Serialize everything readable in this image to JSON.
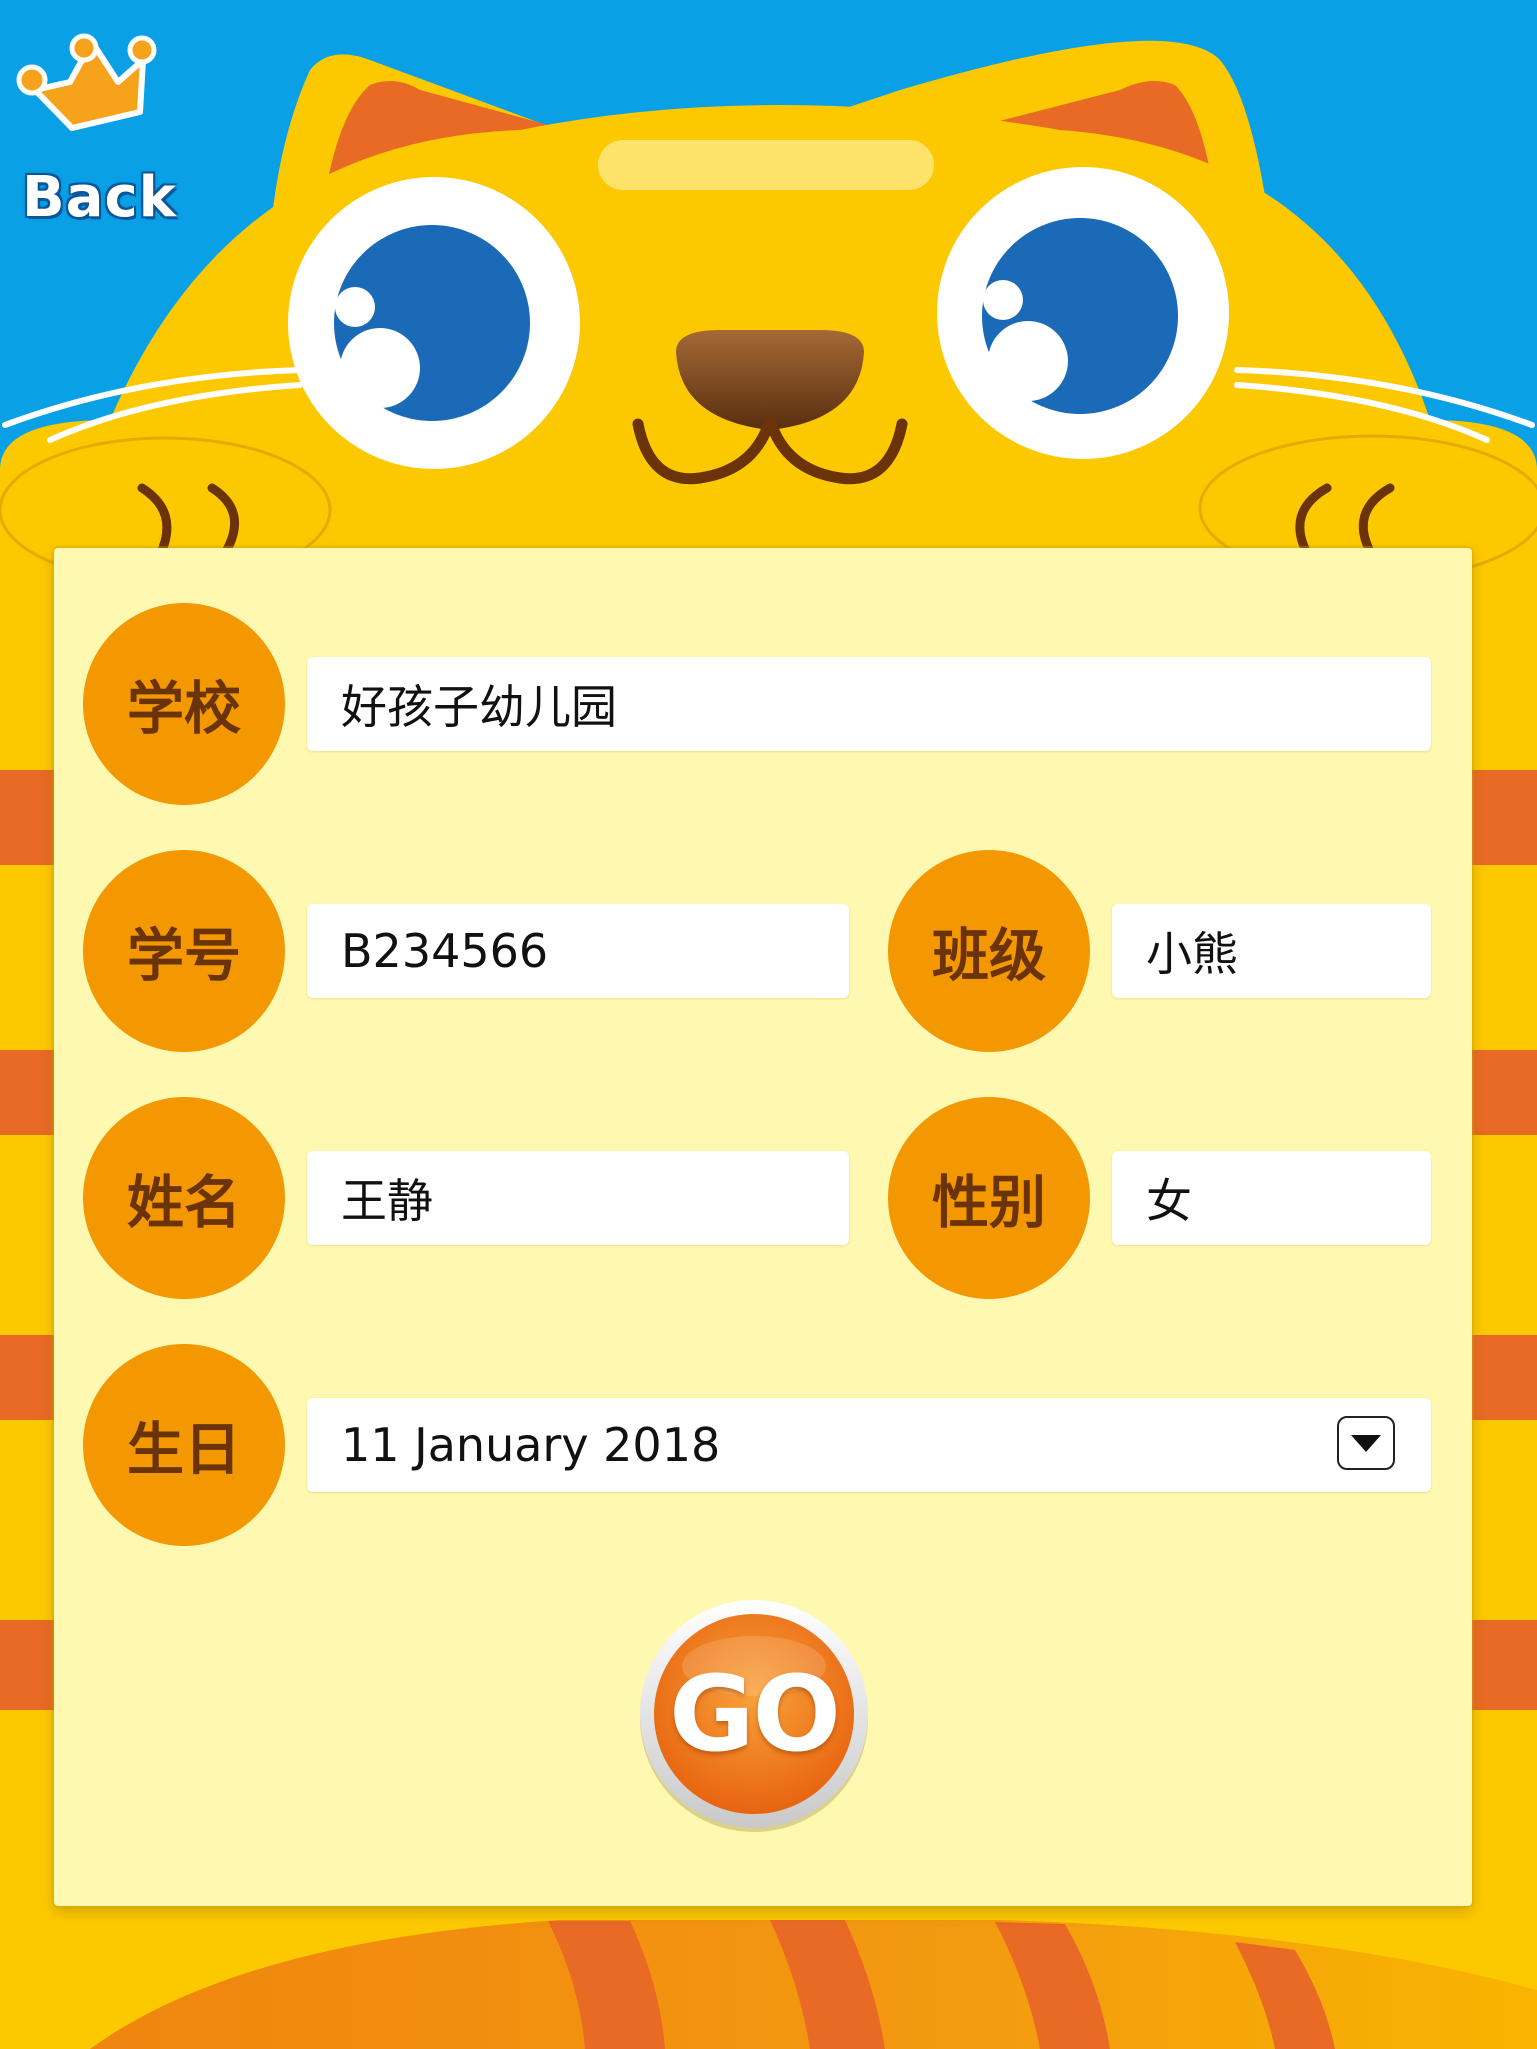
{
  "header": {
    "back_label": "Back"
  },
  "form": {
    "school": {
      "label": "学校",
      "value": "好孩子幼儿园"
    },
    "student_id": {
      "label": "学号",
      "value": "B234566"
    },
    "class": {
      "label": "班级",
      "value": "小熊"
    },
    "name": {
      "label": "姓名",
      "value": "王静"
    },
    "gender": {
      "label": "性别",
      "value": "女"
    },
    "birthday": {
      "label": "生日",
      "value": "11 January 2018"
    }
  },
  "actions": {
    "go_label": "GO"
  },
  "icons": {
    "back": "crown-icon",
    "dropdown": "chevron-down-icon"
  },
  "colors": {
    "sky": "#0aa0e6",
    "cat_yellow": "#fcc900",
    "stripe_orange": "#e86a24",
    "panel": "#fff8b0",
    "badge": "#f39800",
    "badge_text": "#6b3309",
    "eye_blue": "#1a6ab8",
    "go_orange": "#f08a1a"
  }
}
